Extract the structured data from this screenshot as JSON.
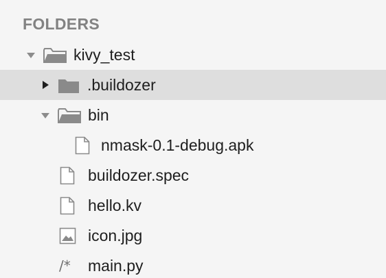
{
  "sidebar": {
    "header": "FOLDERS",
    "items": [
      {
        "label": "kivy_test",
        "type": "folder",
        "state": "open",
        "icon": "folder-open-icon"
      },
      {
        "label": ".buildozer",
        "type": "folder",
        "state": "closed",
        "icon": "folder-icon",
        "selected": true
      },
      {
        "label": "bin",
        "type": "folder",
        "state": "open",
        "icon": "folder-open-icon"
      },
      {
        "label": "nmask-0.1-debug.apk",
        "type": "file",
        "icon": "file-icon"
      },
      {
        "label": "buildozer.spec",
        "type": "file",
        "icon": "file-icon"
      },
      {
        "label": "hello.kv",
        "type": "file",
        "icon": "file-icon"
      },
      {
        "label": "icon.jpg",
        "type": "image",
        "icon": "image-file-icon"
      },
      {
        "label": "main.py",
        "type": "code",
        "icon": "code-file-icon",
        "glyph": "/*"
      }
    ]
  },
  "colors": {
    "background": "#f5f5f5",
    "selected_row": "#dedede",
    "header_text": "#828282",
    "icon": "#8a8a8a"
  }
}
